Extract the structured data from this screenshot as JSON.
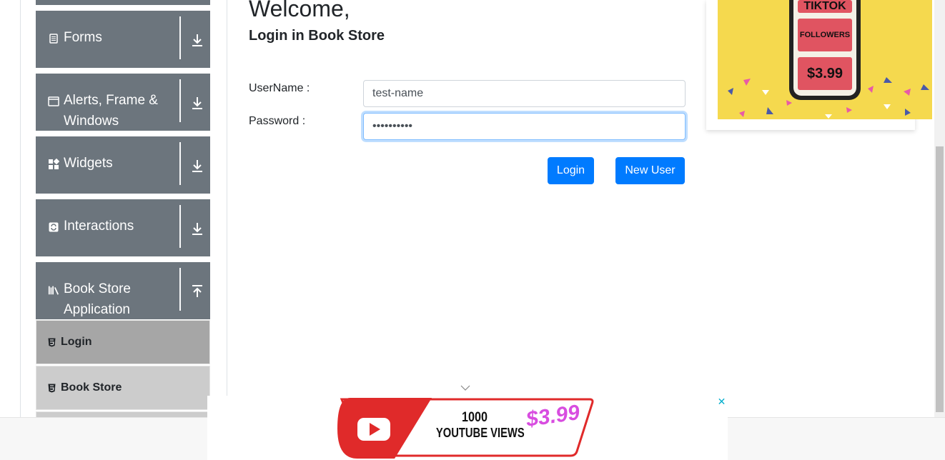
{
  "sidebar": {
    "groups": [
      {
        "label": "Forms",
        "icon": "document-icon"
      },
      {
        "label": "Alerts, Frame & Windows",
        "icon": "window-icon"
      },
      {
        "label": "Widgets",
        "icon": "widgets-icon"
      },
      {
        "label": "Interactions",
        "icon": "interactions-icon"
      },
      {
        "label": "Book Store Application",
        "icon": "books-icon"
      }
    ],
    "sub_items": [
      {
        "label": "Login",
        "active": true
      },
      {
        "label": "Book Store",
        "active": false
      }
    ]
  },
  "main": {
    "heading": "Welcome,",
    "subheading": "Login in Book Store",
    "username_label": "UserName :",
    "username_value": "test-name",
    "password_label": "Password :",
    "password_value": "••••••••••",
    "login_button": "Login",
    "new_user_button": "New User"
  },
  "ads": {
    "top_right": {
      "line1": "TIKTOK",
      "line2": "FOLLOWERS",
      "price": "$3.99"
    },
    "bottom": {
      "line1": "1000",
      "line2": "YOUTUBE VIEWS",
      "price": "$3.99",
      "close": "✕"
    }
  },
  "colors": {
    "sidebar_group": "#6c757d",
    "sub_active": "#a6a6a6",
    "sub_inactive": "#cccccc",
    "primary": "#007bff",
    "ad_yellow": "#f5d94e",
    "ad_red": "#e05461"
  }
}
